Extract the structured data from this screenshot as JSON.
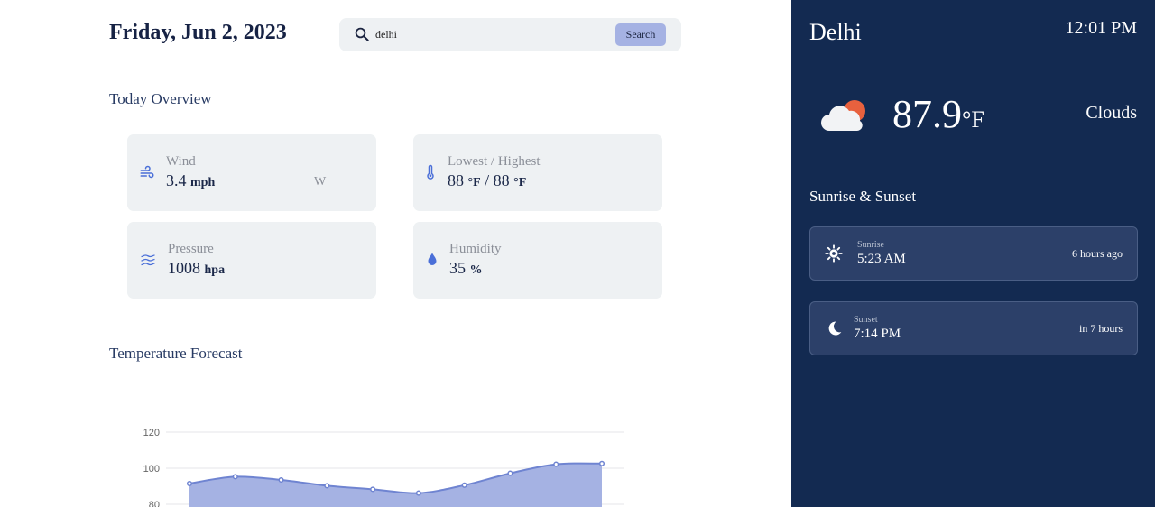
{
  "header": {
    "date": "Friday, Jun 2, 2023"
  },
  "search": {
    "value": "delhi",
    "button_label": "Search"
  },
  "overview": {
    "title": "Today Overview",
    "wind": {
      "label": "Wind",
      "value": "3.4",
      "unit": "mph",
      "direction": "W",
      "icon": "wind-icon"
    },
    "temp_range": {
      "label": "Lowest / Highest",
      "low": "88",
      "high": "88",
      "unit": "°F",
      "separator": "/",
      "icon": "thermometer-icon"
    },
    "pressure": {
      "label": "Pressure",
      "value": "1008",
      "unit": "hpa",
      "icon": "waves-icon"
    },
    "humidity": {
      "label": "Humidity",
      "value": "35",
      "unit": "%",
      "icon": "droplet-icon"
    }
  },
  "forecast": {
    "title": "Temperature Forecast"
  },
  "chart_data": {
    "type": "area",
    "y_ticks": [
      80,
      100,
      120
    ],
    "ylim": [
      60,
      125
    ],
    "values": [
      91.5,
      95.3,
      93.5,
      90.3,
      88.3,
      86.2,
      90.6,
      97.2,
      102.2,
      102.6
    ],
    "grid": true,
    "colors": {
      "line": "#6f84d1",
      "fill": "#a5b2e3",
      "grid": "#e4e6ea"
    }
  },
  "sidebar": {
    "city": "Delhi",
    "time": "12:01 PM",
    "temperature": "87.9",
    "temp_unit": "°F",
    "condition": "Clouds",
    "condition_icon": "cloud-sun-icon",
    "sun_title": "Sunrise & Sunset",
    "sunrise": {
      "label": "Sunrise",
      "time": "5:23 AM",
      "relative": "6 hours ago",
      "icon": "sun-icon"
    },
    "sunset": {
      "label": "Sunset",
      "time": "7:14 PM",
      "relative": "in 7 hours",
      "icon": "moon-icon"
    }
  },
  "colors": {
    "accent": "#a5b2e3",
    "sidebar_bg": "#132a51",
    "card_bg": "#eef1f3",
    "icon_blue": "#4a6fd8"
  }
}
